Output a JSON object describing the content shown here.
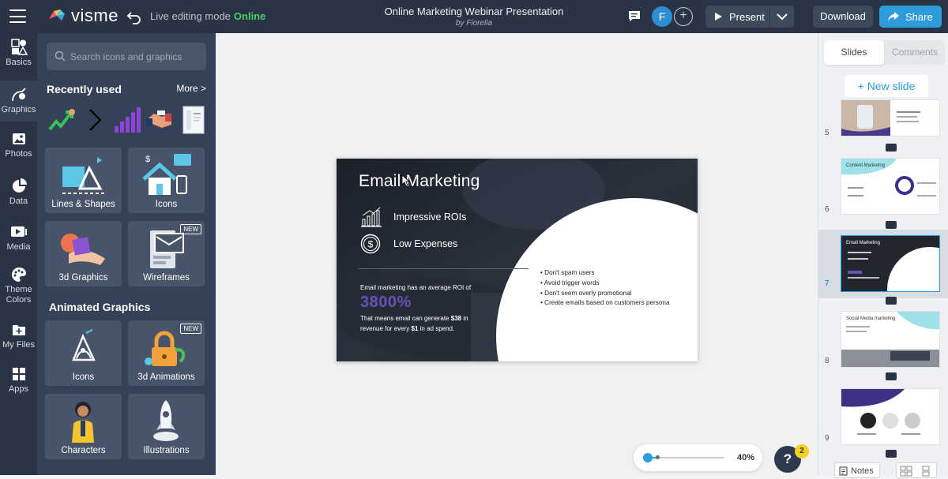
{
  "header": {
    "brand": "visme",
    "mode_label": "Live editing mode",
    "mode_status": "Online",
    "doc_title": "Online Marketing Webinar Presentation",
    "doc_author": "by Fiorella",
    "avatar_initial": "F",
    "present_label": "Present",
    "download_label": "Download",
    "share_label": "Share"
  },
  "rail": {
    "items": [
      {
        "label": "Basics",
        "icon": "basics-icon"
      },
      {
        "label": "Graphics",
        "icon": "graphics-icon"
      },
      {
        "label": "Photos",
        "icon": "photos-icon"
      },
      {
        "label": "Data",
        "icon": "data-icon"
      },
      {
        "label": "Media",
        "icon": "media-icon"
      },
      {
        "label": "Theme Colors",
        "icon": "palette-icon"
      },
      {
        "label": "My Files",
        "icon": "files-icon"
      },
      {
        "label": "Apps",
        "icon": "apps-icon"
      }
    ]
  },
  "panel": {
    "search_placeholder": "Search icons and graphics",
    "recently_used_title": "Recently used",
    "more_label": "More >",
    "cards": [
      {
        "label": "Lines & Shapes"
      },
      {
        "label": "Icons"
      },
      {
        "label": "3d Graphics"
      },
      {
        "label": "Wireframes",
        "badge": "NEW"
      }
    ],
    "animated_title": "Animated Graphics",
    "animated_cards": [
      {
        "label": "Icons"
      },
      {
        "label": "3d Animations",
        "badge": "NEW"
      },
      {
        "label": "Characters"
      },
      {
        "label": "Illustrations"
      }
    ]
  },
  "slide": {
    "title": "Email Marketing",
    "feature_1": "Impressive ROIs",
    "feature_2": "Low Expenses",
    "roi_intro": "Email marketing has an average ROI of",
    "roi_value": "3800%",
    "roi_note_1": "That means email can generate",
    "roi_note_amount": "$38",
    "roi_note_2": "in revenue for every",
    "roi_note_dollar": "$1",
    "roi_note_3": "in ad spend.",
    "bullets": [
      "Don't spam users",
      "Avoid trigger words",
      "Don't seem overly promotional",
      "Create emails based on customers persona"
    ]
  },
  "zoom": {
    "value": "40%",
    "level_fraction": 0.04
  },
  "help": {
    "label": "?",
    "badge": "2"
  },
  "right_panel": {
    "tab_slides": "Slides",
    "tab_comments": "Comments",
    "new_slide_label": "New slide",
    "thumbnails": [
      {
        "number": "5"
      },
      {
        "number": "6",
        "title": "Content Marketing"
      },
      {
        "number": "7",
        "title": "Email Marketing",
        "selected": true
      },
      {
        "number": "8",
        "title": "Social Media marketing"
      },
      {
        "number": "9"
      }
    ],
    "notes_label": "Notes"
  },
  "colors": {
    "topbar": "#293445",
    "accent": "#2d9cdb",
    "online": "#47d16c",
    "roi_purple": "#6a4fb8"
  }
}
